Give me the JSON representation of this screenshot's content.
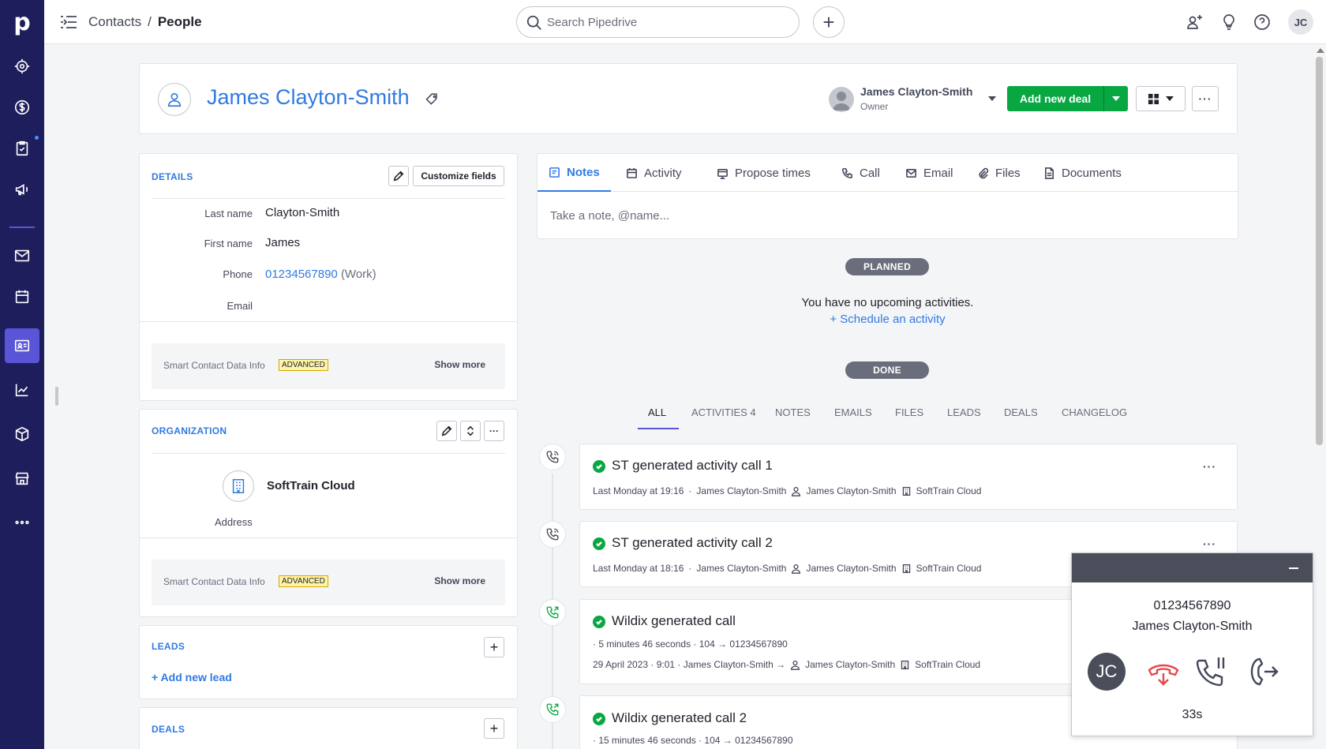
{
  "app": {
    "logo": "p"
  },
  "nav": {
    "items": [
      {
        "name": "leads-icon"
      },
      {
        "name": "deals-icon"
      },
      {
        "name": "activities-icon"
      },
      {
        "name": "campaigns-icon"
      },
      {
        "name": "mail-icon"
      },
      {
        "name": "calendar-icon"
      },
      {
        "name": "contacts-icon",
        "active": true
      },
      {
        "name": "insights-icon"
      },
      {
        "name": "products-icon"
      },
      {
        "name": "marketplace-icon"
      },
      {
        "name": "more-icon"
      }
    ]
  },
  "topbar": {
    "breadcrumb_parent": "Contacts",
    "breadcrumb_sep": "/",
    "breadcrumb_current": "People",
    "search_placeholder": "Search Pipedrive",
    "add_label": "+",
    "user_initials": "JC"
  },
  "person": {
    "name": "James Clayton-Smith",
    "owner_name": "James Clayton-Smith",
    "owner_label": "Owner",
    "add_deal_label": "Add new deal",
    "more_label": "···"
  },
  "details": {
    "title": "DETAILS",
    "customize_label": "Customize fields",
    "fields": [
      {
        "label": "Last name",
        "value": "Clayton-Smith"
      },
      {
        "label": "First name",
        "value": "James"
      },
      {
        "label": "Phone",
        "value": "01234567890",
        "suffix": "(Work)"
      },
      {
        "label": "Email",
        "value": ""
      }
    ],
    "smart_label": "Smart Contact Data Info",
    "smart_badge": "ADVANCED",
    "show_more": "Show more"
  },
  "organization": {
    "title": "ORGANIZATION",
    "name": "SoftTrain Cloud",
    "address_label": "Address",
    "smart_label": "Smart Contact Data Info",
    "smart_badge": "ADVANCED",
    "show_more": "Show more",
    "more_label": "···"
  },
  "leads": {
    "title": "LEADS",
    "add_label": "+ Add new lead",
    "plus": "+"
  },
  "deals": {
    "title": "DEALS",
    "plus": "+"
  },
  "tabs": [
    {
      "label": "Notes",
      "icon": "note-icon",
      "active": true
    },
    {
      "label": "Activity",
      "icon": "calendar-icon"
    },
    {
      "label": "Propose times",
      "icon": "propose-icon"
    },
    {
      "label": "Call",
      "icon": "phone-icon"
    },
    {
      "label": "Email",
      "icon": "mail-icon"
    },
    {
      "label": "Files",
      "icon": "paperclip-icon"
    },
    {
      "label": "Documents",
      "icon": "document-icon"
    }
  ],
  "note_placeholder": "Take a note, @name...",
  "planned": {
    "badge": "PLANNED",
    "empty_text": "You have no upcoming activities.",
    "schedule_link": "+ Schedule an activity"
  },
  "done": {
    "badge": "DONE"
  },
  "filters": [
    {
      "label": "ALL",
      "active": true
    },
    {
      "label": "ACTIVITIES",
      "count": "4"
    },
    {
      "label": "NOTES"
    },
    {
      "label": "EMAILS"
    },
    {
      "label": "FILES"
    },
    {
      "label": "LEADS"
    },
    {
      "label": "DEALS"
    },
    {
      "label": "CHANGELOG"
    }
  ],
  "activities": [
    {
      "title": "ST generated activity call 1",
      "time": "Last Monday at 19:16",
      "sep": "·",
      "owner": "James Clayton-Smith",
      "person": "James Clayton-Smith",
      "org": "SoftTrain Cloud",
      "more": "···"
    },
    {
      "title": "ST generated activity call 2",
      "time": "Last Monday at 18:16",
      "sep": "·",
      "owner": "James Clayton-Smith",
      "person": "James Clayton-Smith",
      "org": "SoftTrain Cloud",
      "more": "···"
    },
    {
      "title": "Wildix generated call",
      "duration_line": "· 5 minutes 46 seconds · 104 → 01234567890",
      "date_line": "29 April 2023 · 9:01 · James Clayton-Smith →",
      "person": "James Clayton-Smith",
      "org": "SoftTrain Cloud"
    },
    {
      "title": "Wildix generated call 2",
      "duration_line": "· 15 minutes 46 seconds · 104 → 01234567890"
    }
  ],
  "phone_widget": {
    "number": "01234567890",
    "name": "James Clayton-Smith",
    "avatar_initials": "JC",
    "timer": "33s",
    "colors": {
      "header": "#4a4e5a",
      "hangup": "#e5484d"
    }
  }
}
